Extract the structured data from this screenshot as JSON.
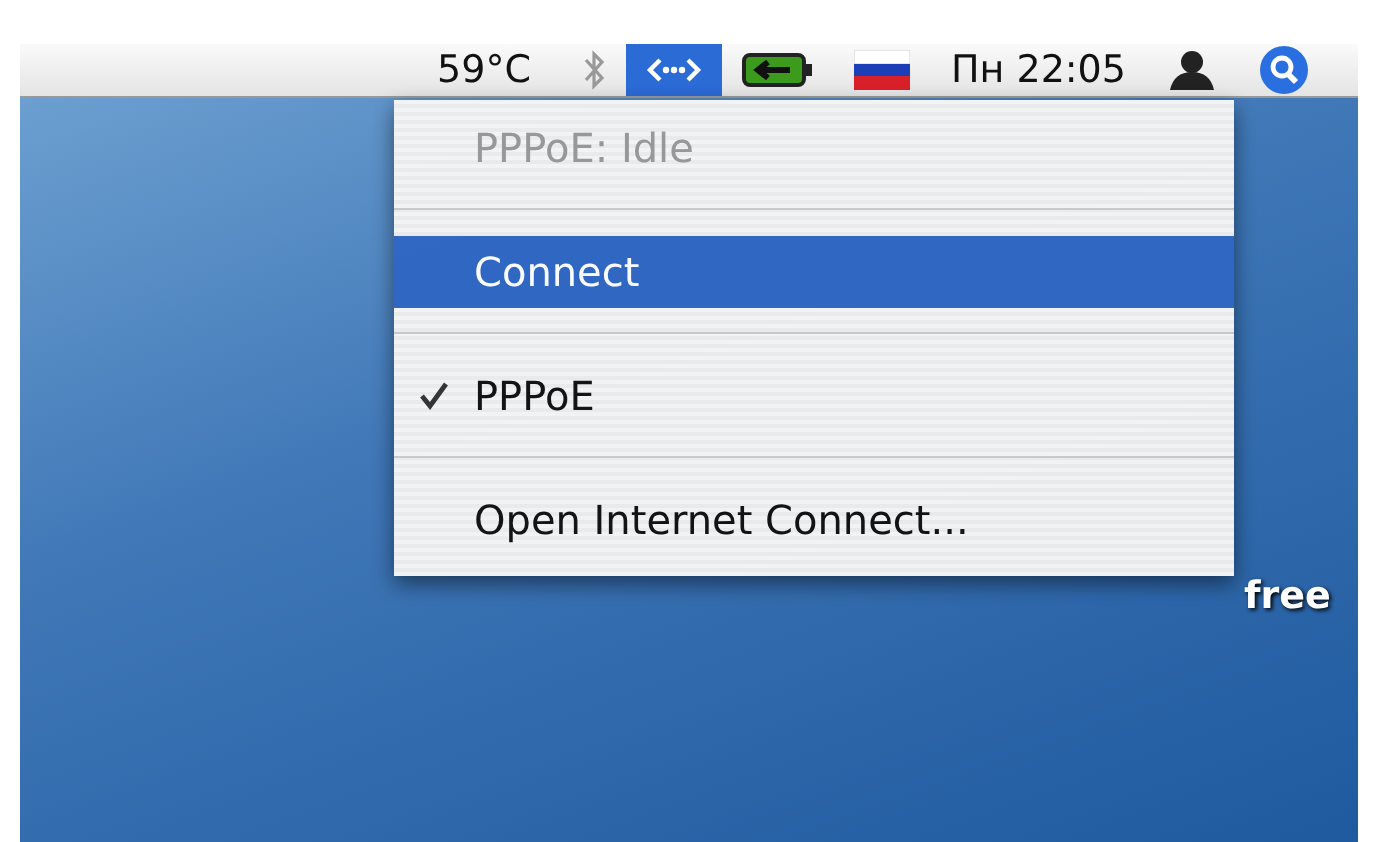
{
  "menu_bar": {
    "items": [
      {
        "kind": "text",
        "label": "59°C",
        "selected": false
      },
      {
        "kind": "bluetooth",
        "selected": false
      },
      {
        "kind": "network",
        "selected": true
      },
      {
        "kind": "battery",
        "selected": false
      },
      {
        "kind": "flag",
        "selected": false
      },
      {
        "kind": "text",
        "label": "Пн 22:05",
        "selected": false
      },
      {
        "kind": "user",
        "selected": false
      },
      {
        "kind": "spotlight",
        "selected": false
      }
    ]
  },
  "menu": {
    "items": [
      {
        "kind": "item",
        "label": "PPPoE: Idle",
        "disabled": true,
        "selected": false,
        "checked": false
      },
      {
        "kind": "separator"
      },
      {
        "kind": "item",
        "label": "Connect",
        "disabled": false,
        "selected": true,
        "checked": false
      },
      {
        "kind": "separator"
      },
      {
        "kind": "item",
        "label": "PPPoE",
        "disabled": false,
        "selected": false,
        "checked": true
      },
      {
        "kind": "separator"
      },
      {
        "kind": "item",
        "label": "Open Internet Connect...",
        "disabled": false,
        "selected": false,
        "checked": false
      }
    ]
  },
  "desktop": {
    "disk_label": "free"
  }
}
